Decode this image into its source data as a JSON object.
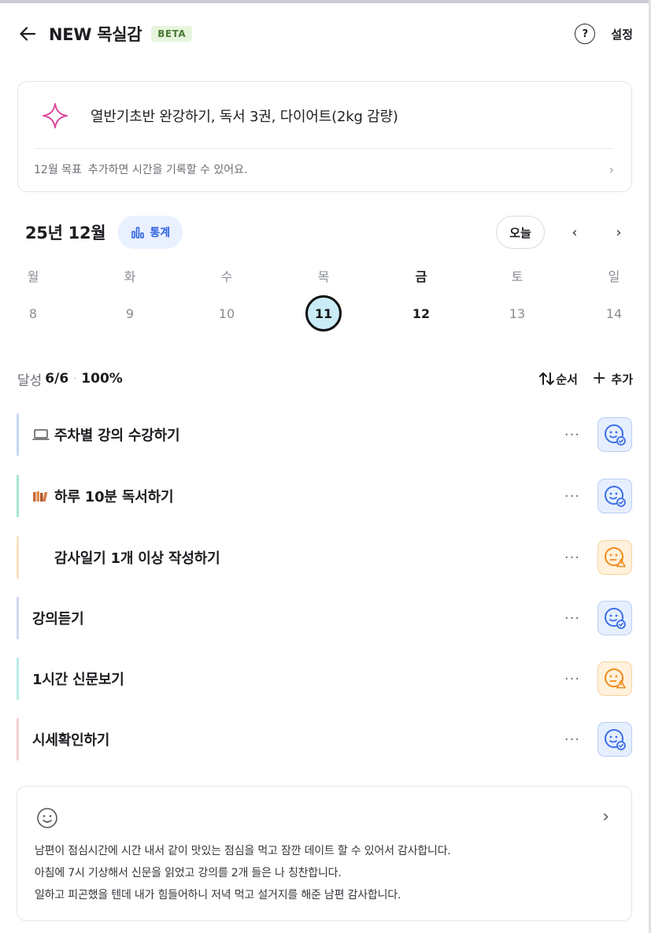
{
  "header": {
    "title": "NEW 목실감",
    "badge": "BETA",
    "help": "?",
    "settings": "설정"
  },
  "goal": {
    "text": "열반기초반 완강하기, 독서 3권, 다이어트(2kg 감량)",
    "month_label": "12월 목표",
    "hint": "추가하면 시간을 기록할 수 있어요.",
    "chevron": "›"
  },
  "calendar": {
    "month": "25년 12월",
    "stats_label": "통계",
    "today_label": "오늘",
    "prev": "‹",
    "next": "›",
    "weekdays": [
      "월",
      "화",
      "수",
      "목",
      "금",
      "토",
      "일"
    ],
    "days": [
      "8",
      "9",
      "10",
      "11",
      "12",
      "13",
      "14"
    ],
    "selected_day": "11"
  },
  "progress": {
    "label": "달성",
    "count": "6/6",
    "dot": "·",
    "percent": "100%",
    "order_label": "순서",
    "add_label": "추가"
  },
  "tasks": [
    {
      "name": "주차별 강의 수강하기",
      "icon": "laptop-icon",
      "bar_color": "#c9d8f5",
      "face": "blue"
    },
    {
      "name": "하루 10분 독서하기",
      "icon": "books-icon",
      "bar_color": "#a8e6cf",
      "face": "blue"
    },
    {
      "name": "감사일기 1개 이상 작성하기",
      "icon": "",
      "bar_color": "#fde2bf",
      "face": "orange"
    },
    {
      "name": "강의듣기",
      "icon": "",
      "bar_color": "#cdd9f3",
      "face": "blue"
    },
    {
      "name": "1시간 신문보기",
      "icon": "",
      "bar_color": "#b8ebe7",
      "face": "orange"
    },
    {
      "name": "시세확인하기",
      "icon": "",
      "bar_color": "#f6d0d0",
      "face": "blue"
    }
  ],
  "task_more": "···",
  "journal": {
    "chevron": "›",
    "lines": [
      "남편이 점심시간에 시간 내서 같이 맛있는 점심을 먹고 잠깐 데이트 할 수 있어서 감사합니다.",
      "아침에 7시 기상해서 신문을 읽었고 강의를 2개 들은 나 칭찬합니다.",
      "일하고 피곤했을 텐데 내가 힘들어하니 저녁 먹고 설거지를 해준 남편 감사합니다."
    ]
  },
  "colors": {
    "accent_blue": "#2f62e0",
    "face_blue": "#3b6ee8",
    "face_orange": "#f08a1c",
    "goal_star": "#e0479a",
    "today_fill": "#c9ecf6"
  }
}
